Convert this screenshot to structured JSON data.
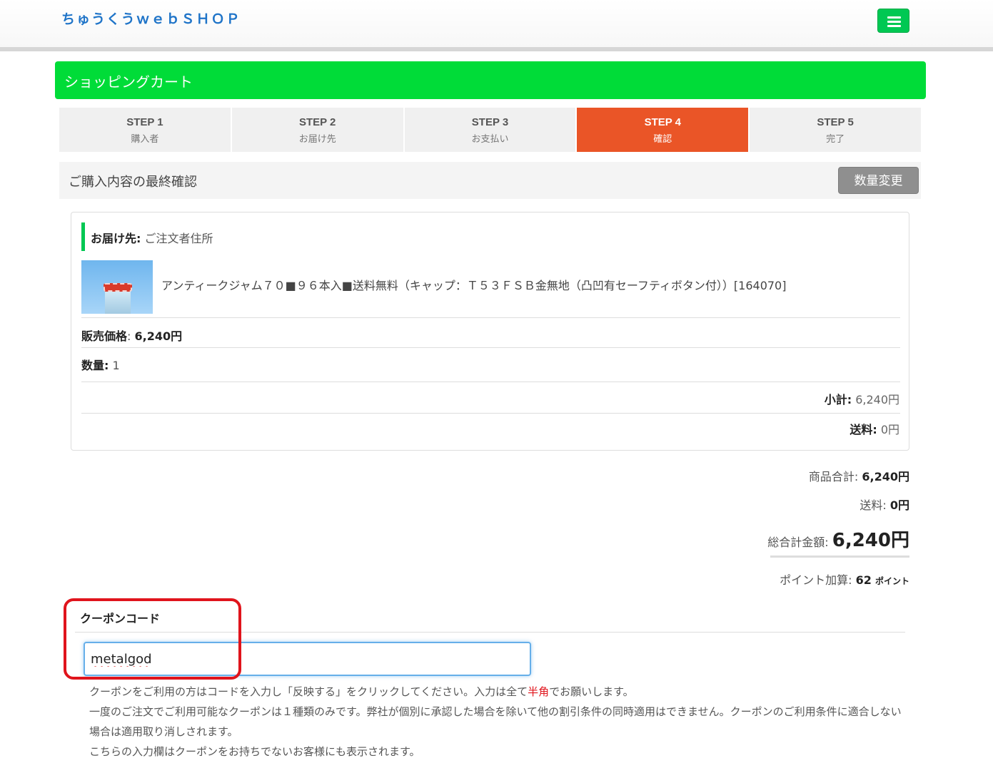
{
  "header": {
    "logo": "ちゅうくうｗｅｂＳＨＯＰ",
    "menu_icon": "hamburger-menu-icon"
  },
  "page_title": "ショッピングカート",
  "steps": [
    {
      "num": "STEP 1",
      "label": "購入者",
      "active": false
    },
    {
      "num": "STEP 2",
      "label": "お届け先",
      "active": false
    },
    {
      "num": "STEP 3",
      "label": "お支払い",
      "active": false
    },
    {
      "num": "STEP 4",
      "label": "確認",
      "active": true
    },
    {
      "num": "STEP 5",
      "label": "完了",
      "active": false
    }
  ],
  "confirm": {
    "title": "ご購入内容の最終確認",
    "qty_change_button": "数量変更"
  },
  "cart": {
    "delivery_label": "お届け先:",
    "delivery_value": "ご注文者住所",
    "product_name": "アンティークジャム７０■９６本入■送料無料（キャップ：Ｔ５３ＦＳＢ金無地（凸凹有セーフティボタン付））[164070]",
    "price_label": "販売価格",
    "price_value": "6,240円",
    "qty_label": "数量:",
    "qty_value": "1",
    "subtotal_label": "小計:",
    "subtotal_value": "6,240円",
    "shipping_label": "送料:",
    "shipping_value": "0円"
  },
  "totals": {
    "items_total_label": "商品合計:",
    "items_total_value": "6,240円",
    "shipping_label": "送料:",
    "shipping_value": "0円",
    "grand_total_label": "総合計金額:",
    "grand_total_value": "6,240円",
    "points_label": "ポイント加算:",
    "points_value": "62",
    "points_unit": "ポイント"
  },
  "coupon": {
    "title": "クーポンコード",
    "input_value": "metalgod",
    "note1_a": "クーポンをご利用の方はコードを入力し「反映する」をクリックしてください。入力は全て",
    "note1_red": "半角",
    "note1_b": "でお願いします。",
    "note2": "一度のご注文でご利用可能なクーポンは１種類のみです。弊社が個別に承認した場合を除いて他の割引条件の同時適用はできません。クーポンのご利用条件に適合しない場合は適用取り消しされます。",
    "note3": "こちらの入力欄はクーポンをお持ちでないお客様にも表示されます。"
  },
  "colors": {
    "accent_green": "#00dc38",
    "step_active": "#ea5527",
    "logo_blue": "#1f74c8",
    "highlight_red": "#e0141c"
  }
}
